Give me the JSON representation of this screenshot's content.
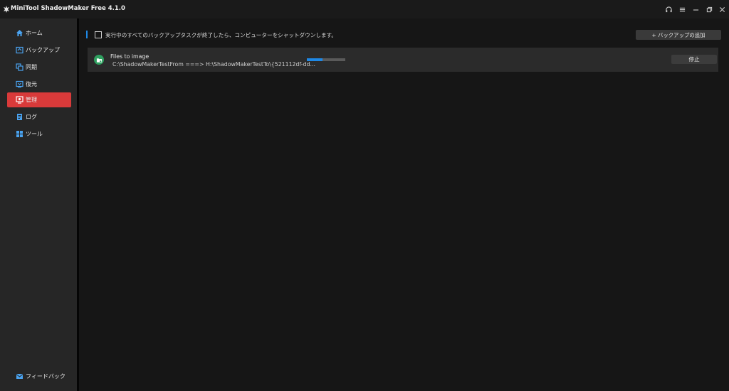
{
  "app": {
    "title": "MiniTool ShadowMaker Free 4.1.0",
    "accent_color": "#1e88e5",
    "active_color": "#d93a3a"
  },
  "window_controls": [
    "headset-icon",
    "menu-icon",
    "minimize-icon",
    "restore-icon",
    "close-icon"
  ],
  "sidebar": {
    "items": [
      {
        "label": "ホーム",
        "icon": "home-icon",
        "active": false
      },
      {
        "label": "バックアップ",
        "icon": "backup-icon",
        "active": false
      },
      {
        "label": "同期",
        "icon": "sync-icon",
        "active": false
      },
      {
        "label": "復元",
        "icon": "restore-icon",
        "active": false
      },
      {
        "label": "管理",
        "icon": "manage-icon",
        "active": true
      },
      {
        "label": "ログ",
        "icon": "log-icon",
        "active": false
      },
      {
        "label": "ツール",
        "icon": "tools-icon",
        "active": false
      }
    ],
    "feedback_label": "フィードバック"
  },
  "main": {
    "shutdown_checkbox_label": "実行中のすべてのバックアップタスクが終了したら、コンピューターをシャットダウンします。",
    "shutdown_checked": false,
    "add_backup_label": "+ バックアップの追加",
    "tasks": [
      {
        "name": "Files to image",
        "path": "C:\\ShadowMakerTestFrom ===> H:\\ShadowMakerTestTo\\{521112df-dd...",
        "progress": 0.4,
        "stop_label": "停止"
      }
    ]
  }
}
